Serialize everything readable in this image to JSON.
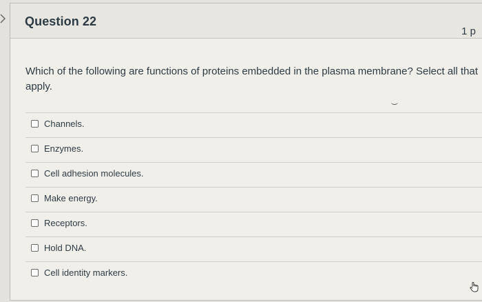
{
  "question": {
    "title": "Question 22",
    "points": "1 p",
    "text": "Which of the following are functions of proteins embedded in the plasma membrane? Select all that apply."
  },
  "answers": [
    {
      "label": "Channels.",
      "checked": false
    },
    {
      "label": "Enzymes.",
      "checked": false
    },
    {
      "label": "Cell adhesion molecules.",
      "checked": false
    },
    {
      "label": "Make energy.",
      "checked": false
    },
    {
      "label": "Receptors.",
      "checked": false
    },
    {
      "label": "Hold DNA.",
      "checked": false
    },
    {
      "label": "Cell identity markers.",
      "checked": false
    }
  ],
  "icons": {
    "left": "chevron-right-icon",
    "cursor": "hand-pointer-icon"
  },
  "colors": {
    "text": "#2d3b45",
    "background": "#f1efea",
    "header": "#e8e6e1"
  }
}
